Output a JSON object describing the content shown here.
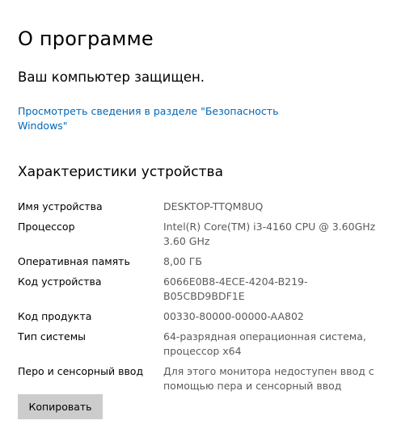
{
  "page": {
    "title": "О программе",
    "status": "Ваш компьютер защищен.",
    "security_link": "Просмотреть сведения в разделе \"Безопасность Windows\""
  },
  "device_specs": {
    "title": "Характеристики устройства",
    "rows": [
      {
        "label": "Имя устройства",
        "value": "DESKTOP-TTQM8UQ"
      },
      {
        "label": "Процессор",
        "value": "Intel(R) Core(TM) i3-4160 CPU @ 3.60GHz 3.60 GHz"
      },
      {
        "label": "Оперативная память",
        "value": "8,00 ГБ"
      },
      {
        "label": "Код устройства",
        "value": "6066E0B8-4ECE-4204-B219-B05CBD9BDF1E"
      },
      {
        "label": "Код продукта",
        "value": "00330-80000-00000-AA802"
      },
      {
        "label": "Тип системы",
        "value": "64-разрядная операционная система, процессор x64"
      },
      {
        "label": "Перо и сенсорный ввод",
        "value": "Для этого монитора недоступен ввод с помощью пера и сенсорный ввод"
      }
    ],
    "copy_button": "Копировать"
  },
  "colors": {
    "link": "#0067b8",
    "value_text": "#5a5a5a",
    "button_bg": "#cccccc"
  }
}
